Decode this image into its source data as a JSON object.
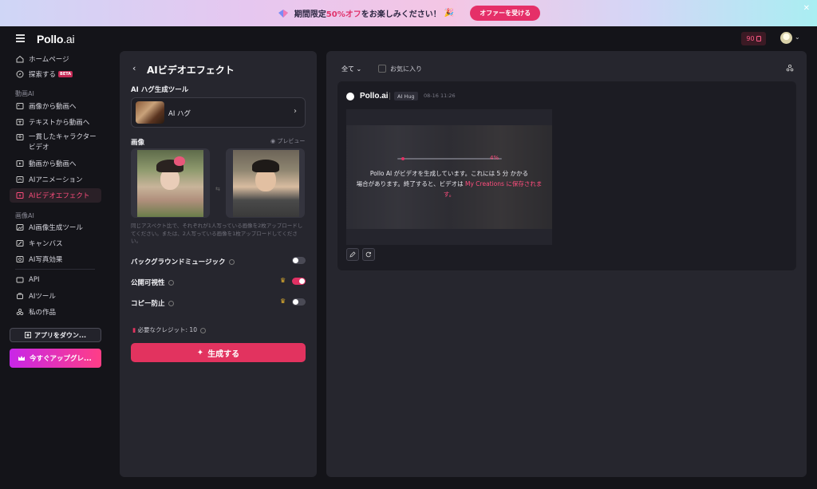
{
  "promo": {
    "text_before": "期間限定",
    "highlight": "50%オフ",
    "text_after": "をお楽しみください！",
    "button": "オファーを受ける",
    "close": "✕"
  },
  "header": {
    "logo_main": "Pollo",
    "logo_suffix": ".ai",
    "credits": "90"
  },
  "sidebar": {
    "items_top": [
      {
        "label": "ホームページ",
        "icon": "home-icon"
      },
      {
        "label": "探索する",
        "icon": "compass-icon",
        "badge": "BETA"
      }
    ],
    "section_video": "動画AI",
    "video_items": [
      {
        "label": "画像から動画へ",
        "icon": "image-video-icon"
      },
      {
        "label": "テキストから動画へ",
        "icon": "text-video-icon"
      },
      {
        "label": "一貫したキャラクター",
        "label2": "ビデオ",
        "icon": "character-icon"
      },
      {
        "label": "動画から動画へ",
        "icon": "video-video-icon"
      },
      {
        "label": "AIアニメーション",
        "icon": "animation-icon"
      },
      {
        "label": "AIビデオエフェクト",
        "icon": "effects-icon",
        "active": true
      }
    ],
    "section_image": "画像AI",
    "image_items": [
      {
        "label": "AI画像生成ツール",
        "icon": "image-gen-icon"
      },
      {
        "label": "キャンバス",
        "icon": "canvas-icon"
      },
      {
        "label": "AI写真効果",
        "icon": "photo-effect-icon"
      }
    ],
    "bottom_items": [
      {
        "label": "API",
        "icon": "api-icon"
      },
      {
        "label": "AIツール",
        "icon": "tools-icon"
      },
      {
        "label": "私の作品",
        "icon": "works-icon"
      }
    ],
    "app_button": "アプリをダウン...",
    "upgrade_button": "今すぐアップグレ..."
  },
  "left_panel": {
    "title": "AIビデオエフェクト",
    "tool_label": "AI ハグ生成ツール",
    "tool_name": "AI ハグ",
    "image_label": "画像",
    "preview": "プレビュー",
    "hint": "同じアスペクト比で、それぞれが1人写っている画像を2枚アップロードしてください。または、2人写っている画像を1枚アップロードしてください。",
    "bgm_label": "バックグラウンドミュージック",
    "public_label": "公開可視性",
    "copy_label": "コピー防止",
    "credits_required": "必要なクレジット: 10",
    "generate_button": "生成する",
    "toggles": {
      "bgm": false,
      "public": true,
      "copy": false
    }
  },
  "right_panel": {
    "filter": "全て",
    "favorites": "お気に入り",
    "card": {
      "brand": "Pollo.ai",
      "tag": "AI Hug",
      "time": "08-16 11:26",
      "progress_pct": "4%",
      "progress_value": 0.04,
      "message_1": "Pollo AI がビデオを生成しています。これには 5 分 かかる",
      "message_2": "場合があります。終了すると、ビデオは ",
      "message_link": "My Creations に保存されます。"
    }
  },
  "colors": {
    "accent": "#e2335f",
    "bg": "#141419",
    "panel": "#26262e"
  }
}
